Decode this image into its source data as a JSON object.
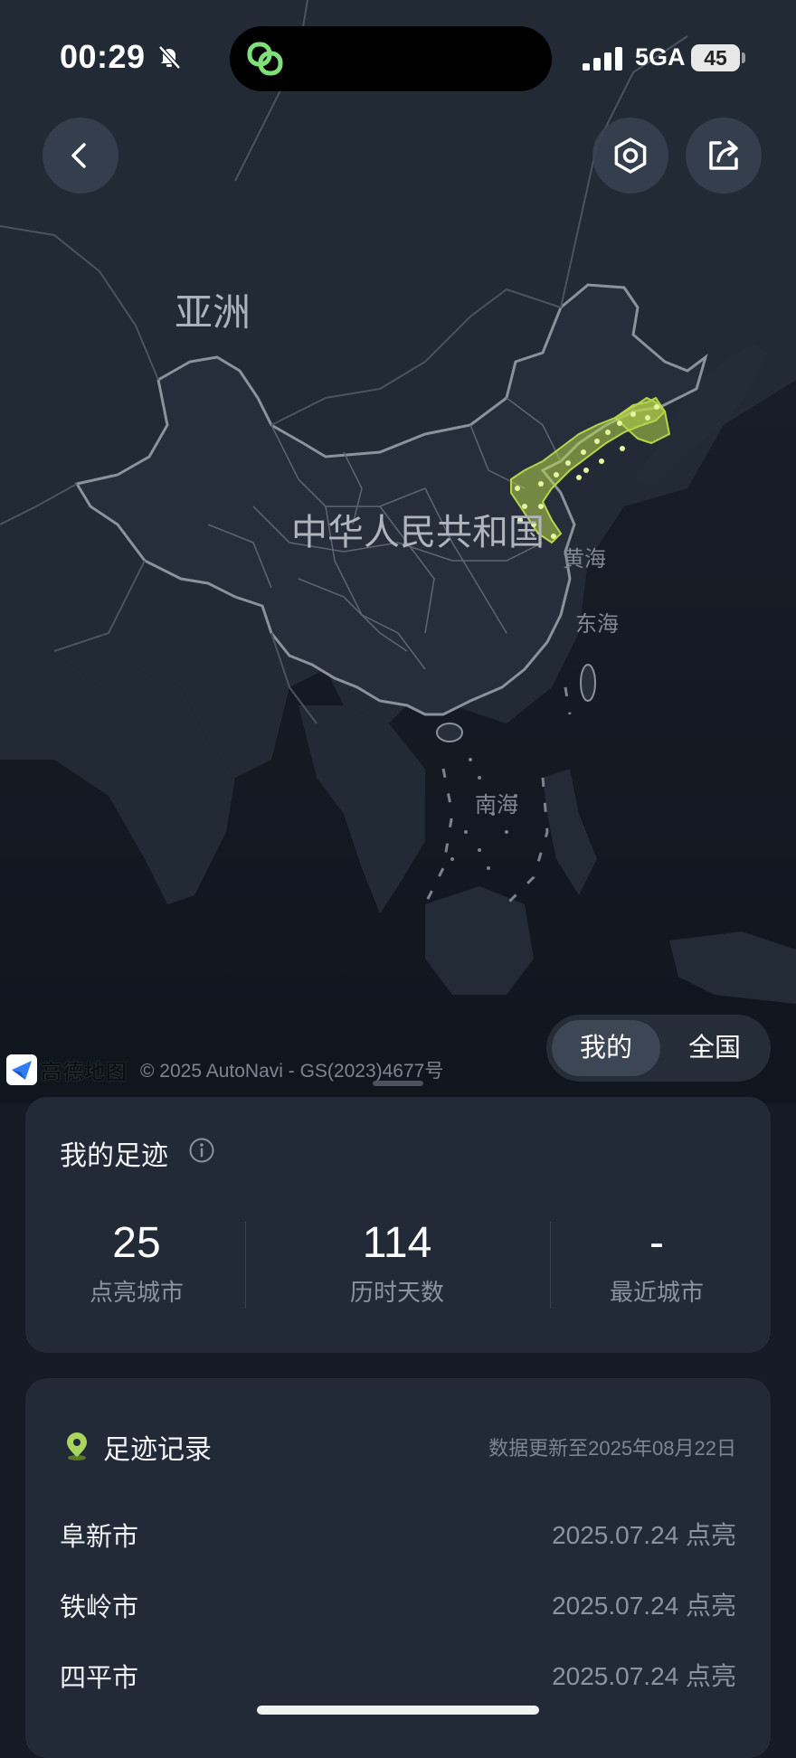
{
  "status_bar": {
    "time": "00:29",
    "network": "5GA",
    "battery": "45"
  },
  "map": {
    "labels": {
      "asia": "亚洲",
      "country": "中华人民共和国",
      "yellow_sea": "黄海",
      "east_sea": "东海",
      "south_sea": "南海"
    },
    "attribution": {
      "logo_text": "高德地图",
      "copyright": "© 2025 AutoNavi - GS(2023)4677号"
    },
    "highlight_color": "#b5d64a"
  },
  "scope_toggle": {
    "mine": "我的",
    "all": "全国",
    "selected": "我的"
  },
  "footprint": {
    "title": "我的足迹",
    "stats": [
      {
        "value": "25",
        "label": "点亮城市"
      },
      {
        "value": "114",
        "label": "历时天数"
      },
      {
        "value": "-",
        "label": "最近城市"
      }
    ]
  },
  "records": {
    "title": "足迹记录",
    "updated": "数据更新至2025年08月22日",
    "items": [
      {
        "city": "阜新市",
        "date": "2025.07.24 点亮"
      },
      {
        "city": "铁岭市",
        "date": "2025.07.24 点亮"
      },
      {
        "city": "四平市",
        "date": "2025.07.24 点亮"
      }
    ]
  },
  "icons": {
    "back": "chevron-left-icon",
    "settings": "hexagon-settings-icon",
    "share": "share-icon",
    "info": "info-icon",
    "pin": "location-pin-icon"
  }
}
